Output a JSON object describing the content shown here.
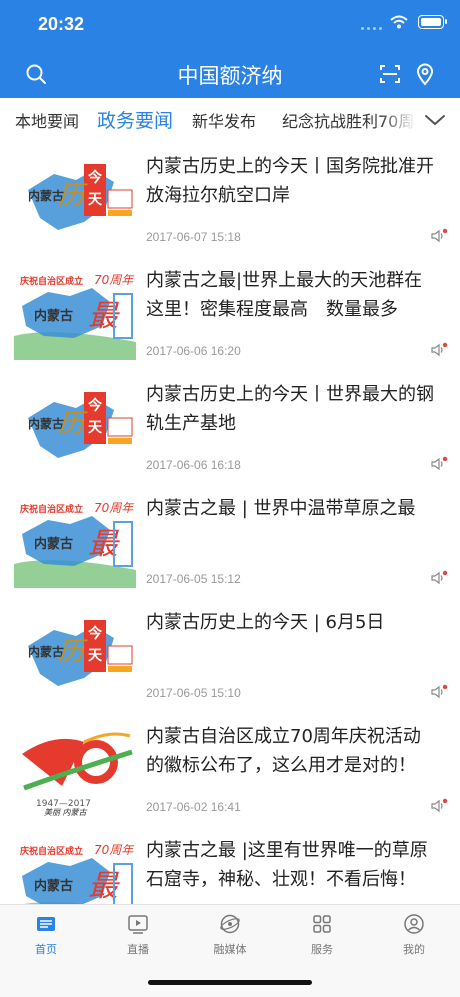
{
  "status": {
    "time": "20:32"
  },
  "header": {
    "title": "中国额济纳"
  },
  "tabs": [
    "本地要闻",
    "政务要闻",
    "新华发布",
    "纪念抗战胜利70周"
  ],
  "active_tab_index": 1,
  "colors": {
    "brand": "#2a82e4",
    "badge": "#e64340"
  },
  "articles": [
    {
      "title": "内蒙古历史上的今天丨国务院批准开放海拉尔航空口岸",
      "date": "2017-06-07 15:18",
      "thumb": "today-in-history"
    },
    {
      "title": "内蒙古之最|世界上最大的天池群在这里！密集程度最高　数量最多",
      "date": "2017-06-06 16:20",
      "thumb": "inner-mongolia-best"
    },
    {
      "title": "内蒙古历史上的今天丨世界最大的钢轨生产基地",
      "date": "2017-06-06 16:18",
      "thumb": "today-in-history"
    },
    {
      "title": "内蒙古之最 | 世界中温带草原之最",
      "date": "2017-06-05 15:12",
      "thumb": "inner-mongolia-best"
    },
    {
      "title": "内蒙古历史上的今天 | 6月5日",
      "date": "2017-06-05 15:10",
      "thumb": "today-in-history"
    },
    {
      "title": "内蒙古自治区成立70周年庆祝活动的徽标公布了，这么用才是对的！",
      "date": "2017-06-02 16:41",
      "thumb": "70-anniversary-logo"
    },
    {
      "title": "内蒙古之最 |这里有世界唯一的草原石窟寺，神秘、壮观！不看后悔！",
      "date": "",
      "thumb": "inner-mongolia-best"
    }
  ],
  "tabbar": [
    {
      "label": "首页",
      "icon": "home-news-icon"
    },
    {
      "label": "直播",
      "icon": "live-play-icon"
    },
    {
      "label": "融媒体",
      "icon": "media-globe-icon"
    },
    {
      "label": "服务",
      "icon": "services-grid-icon"
    },
    {
      "label": "我的",
      "icon": "profile-icon"
    }
  ]
}
